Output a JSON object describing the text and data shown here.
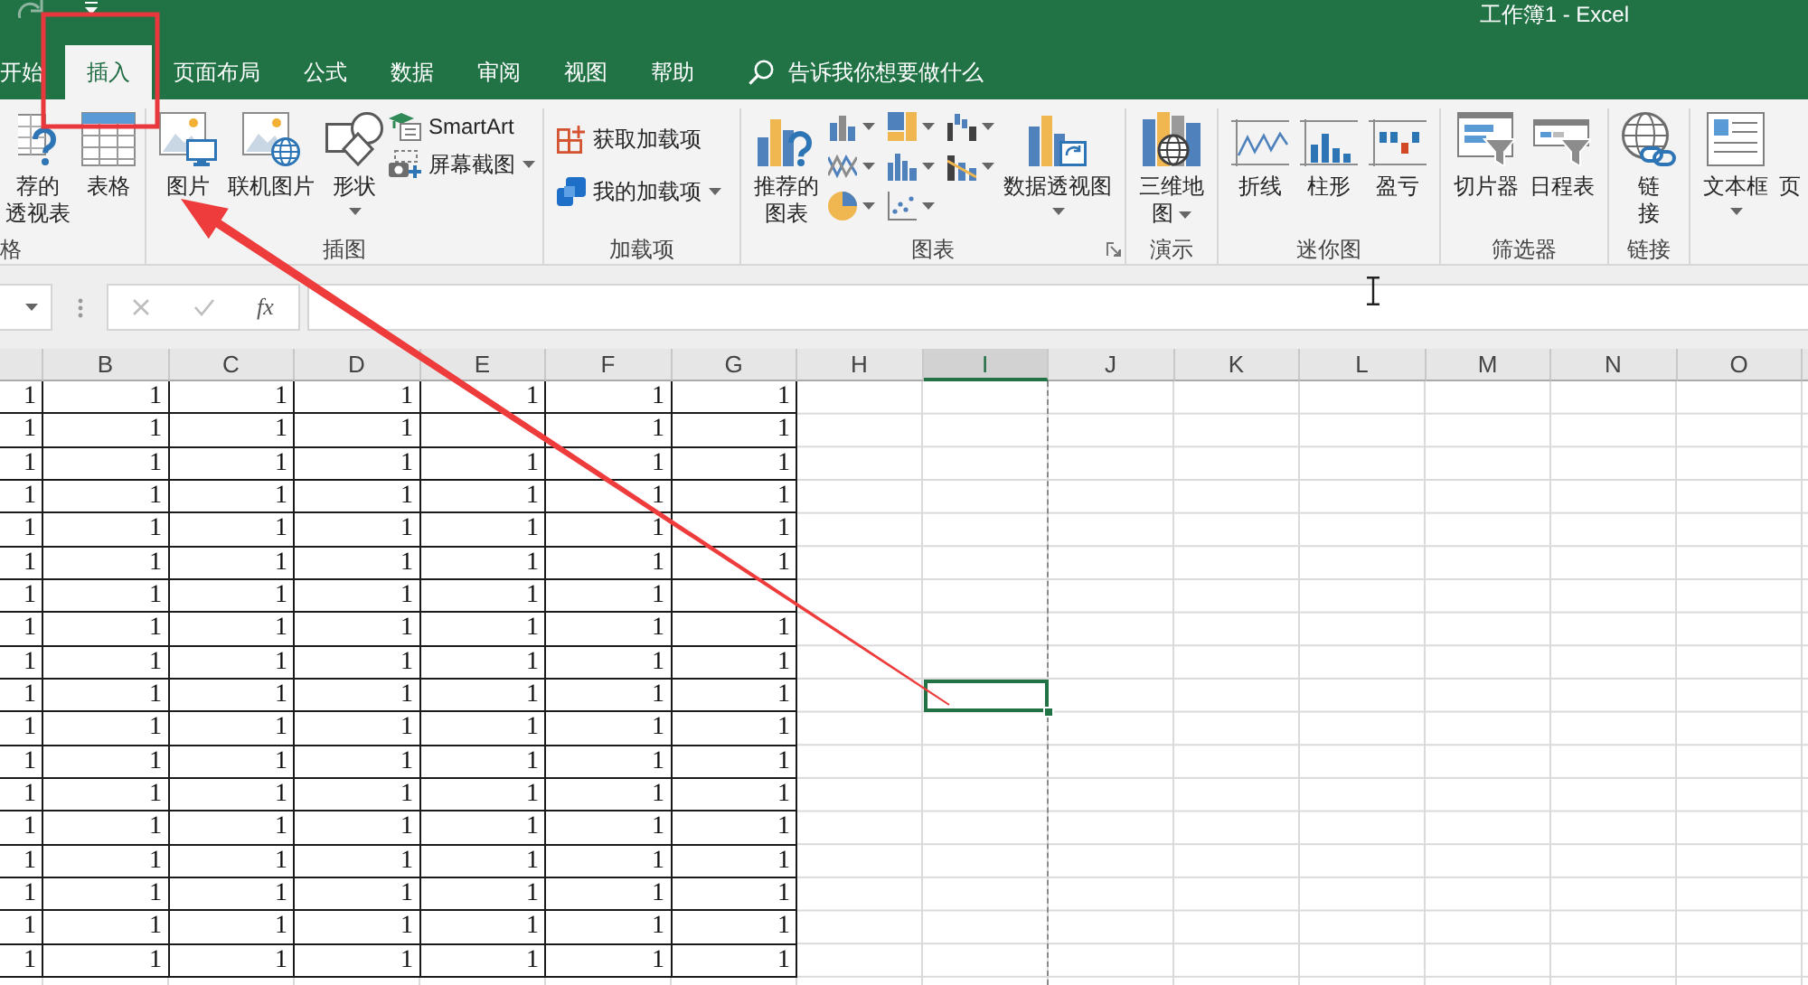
{
  "window": {
    "title": "工作簿1 - Excel"
  },
  "tabs": [
    {
      "label": "开始",
      "selected": false
    },
    {
      "label": "插入",
      "selected": true
    },
    {
      "label": "页面布局",
      "selected": false
    },
    {
      "label": "公式",
      "selected": false
    },
    {
      "label": "数据",
      "selected": false
    },
    {
      "label": "审阅",
      "selected": false
    },
    {
      "label": "视图",
      "selected": false
    },
    {
      "label": "帮助",
      "selected": false
    }
  ],
  "search": {
    "placeholder": "告诉我你想要做什么"
  },
  "ribbon": {
    "groups": [
      {
        "label": "格",
        "items": [
          {
            "kind": "large",
            "lines": [
              "荐的",
              "透视表"
            ],
            "dropdown": false
          },
          {
            "kind": "large",
            "label": "表格",
            "dropdown": false
          }
        ]
      },
      {
        "label": "插图",
        "items": [
          {
            "kind": "large",
            "label": "图片",
            "dropdown": false
          },
          {
            "kind": "large",
            "label": "联机图片",
            "dropdown": false
          },
          {
            "kind": "large",
            "label": "形状",
            "dropdown": true
          },
          {
            "kind": "stack",
            "buttons": [
              {
                "label": "SmartArt",
                "dropdown": false
              },
              {
                "label": "屏幕截图",
                "dropdown": true
              }
            ]
          }
        ]
      },
      {
        "label": "加载项",
        "items": [
          {
            "kind": "pair",
            "buttons": [
              {
                "label": "获取加载项",
                "dropdown": false
              },
              {
                "label": "我的加载项",
                "dropdown": true
              }
            ]
          }
        ]
      },
      {
        "label": "图表",
        "launcher": true,
        "items": [
          {
            "kind": "large",
            "lines": [
              "推荐的",
              "图表"
            ],
            "dropdown": false
          },
          {
            "kind": "chart_grid"
          },
          {
            "kind": "large",
            "label": "数据透视图",
            "dropdown": true
          }
        ]
      },
      {
        "label": "演示",
        "items": [
          {
            "kind": "large",
            "lines": [
              "三维地",
              "图"
            ],
            "dropdown": true
          }
        ]
      },
      {
        "label": "迷你图",
        "items": [
          {
            "kind": "large",
            "label": "折线",
            "dropdown": false
          },
          {
            "kind": "large",
            "label": "柱形",
            "dropdown": false
          },
          {
            "kind": "large",
            "label": "盈亏",
            "dropdown": false
          }
        ]
      },
      {
        "label": "筛选器",
        "items": [
          {
            "kind": "large",
            "label": "切片器",
            "dropdown": false
          },
          {
            "kind": "large",
            "label": "日程表",
            "dropdown": false
          }
        ]
      },
      {
        "label": "链接",
        "items": [
          {
            "kind": "large",
            "lines": [
              "链",
              "接"
            ],
            "dropdown": false
          }
        ]
      },
      {
        "items": [
          {
            "kind": "large",
            "label": "文本框",
            "dropdown": true
          },
          {
            "kind": "large",
            "label": "页",
            "dropdown": false
          }
        ]
      }
    ]
  },
  "formula_bar": {
    "function_button": "fx"
  },
  "sheet": {
    "columns": [
      {
        "selected": false,
        "page_break": false
      },
      {
        "label": "B",
        "selected": false,
        "page_break": false
      },
      {
        "label": "C",
        "selected": false,
        "page_break": false
      },
      {
        "label": "D",
        "selected": false,
        "page_break": false
      },
      {
        "label": "E",
        "selected": false,
        "page_break": false
      },
      {
        "label": "F",
        "selected": false,
        "page_break": false
      },
      {
        "label": "G",
        "selected": false,
        "page_break": false
      },
      {
        "label": "H",
        "selected": false,
        "page_break": false
      },
      {
        "label": "I",
        "selected": true,
        "page_break": true
      },
      {
        "label": "J",
        "selected": false,
        "page_break": false
      },
      {
        "label": "K",
        "selected": false,
        "page_break": false
      },
      {
        "label": "L",
        "selected": false,
        "page_break": false
      },
      {
        "label": "M",
        "selected": false,
        "page_break": false
      },
      {
        "label": "N",
        "selected": false,
        "page_break": false
      },
      {
        "label": "O",
        "selected": false,
        "page_break": false
      }
    ],
    "rows": [
      {
        "cells": [
          "1",
          "1",
          "1",
          "1",
          "1",
          "1",
          "1"
        ],
        "active": false
      },
      {
        "cells": [
          "1",
          "1",
          "1",
          "1",
          null,
          "1",
          "1"
        ],
        "active": false
      },
      {
        "cells": [
          "1",
          "1",
          "1",
          "1",
          "1",
          "1",
          "1"
        ],
        "active": false
      },
      {
        "cells": [
          "1",
          "1",
          "1",
          "1",
          "1",
          "1",
          "1"
        ],
        "active": false
      },
      {
        "cells": [
          "1",
          "1",
          "1",
          "1",
          "1",
          "1",
          "1"
        ],
        "active": false
      },
      {
        "cells": [
          "1",
          "1",
          "1",
          "1",
          "1",
          "1",
          "1"
        ],
        "active": false
      },
      {
        "cells": [
          "1",
          "1",
          "1",
          "1",
          "1",
          "1",
          null
        ],
        "active": false
      },
      {
        "cells": [
          "1",
          "1",
          "1",
          "1",
          "1",
          "1",
          "1"
        ],
        "active": false
      },
      {
        "cells": [
          "1",
          "1",
          "1",
          "1",
          "1",
          "1",
          "1"
        ],
        "active": false
      },
      {
        "cells": [
          "1",
          "1",
          "1",
          "1",
          "1",
          "1",
          "1"
        ],
        "active": true
      },
      {
        "cells": [
          "1",
          "1",
          "1",
          "1",
          "1",
          "1",
          "1"
        ],
        "active": false
      },
      {
        "cells": [
          "1",
          "1",
          "1",
          "1",
          "1",
          "1",
          "1"
        ],
        "active": false
      },
      {
        "cells": [
          "1",
          "1",
          "1",
          "1",
          "1",
          "1",
          "1"
        ],
        "active": false
      },
      {
        "cells": [
          "1",
          "1",
          "1",
          "1",
          "1",
          "1",
          "1"
        ],
        "active": false
      },
      {
        "cells": [
          "1",
          "1",
          "1",
          "1",
          "1",
          "1",
          "1"
        ],
        "active": false
      },
      {
        "cells": [
          "1",
          "1",
          "1",
          "1",
          "1",
          "1",
          "1"
        ],
        "active": false
      },
      {
        "cells": [
          "1",
          "1",
          "1",
          "1",
          "1",
          "1",
          "1"
        ],
        "active": false
      },
      {
        "cells": [
          "1",
          "1",
          "1",
          "1",
          "1",
          "1",
          "1"
        ],
        "active": false
      }
    ]
  }
}
